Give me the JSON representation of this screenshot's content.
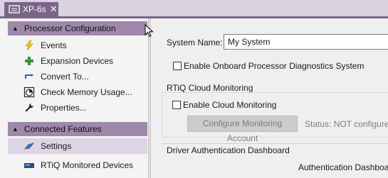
{
  "tab": {
    "title": "XP-6s",
    "close_glyph": "✕",
    "icon": "device-icon"
  },
  "sidebar": {
    "groups": [
      {
        "title": "Processor Configuration",
        "items": [
          {
            "label": "Events",
            "icon": "lightning-icon"
          },
          {
            "label": "Expansion Devices",
            "icon": "plus-icon"
          },
          {
            "label": "Convert To...",
            "icon": "convert-icon"
          },
          {
            "label": "Check Memory Usage...",
            "icon": "memory-icon"
          },
          {
            "label": "Properties...",
            "icon": "wrench-icon"
          }
        ]
      },
      {
        "title": "Connected Features",
        "items": [
          {
            "label": "Settings",
            "icon": "settings-icon",
            "selected": true
          },
          {
            "label": "RTiQ Monitored Devices",
            "icon": "device-icon"
          }
        ]
      }
    ]
  },
  "main": {
    "system_name_label": "System Name:",
    "system_name_value": "My System",
    "enable_onboard_label": "Enable Onboard Processor Diagnostics System",
    "cloud_section_title": "RTiQ Cloud Monitoring",
    "enable_cloud_label": "Enable Cloud Monitoring",
    "configure_button": "Configure Monitoring Account",
    "status_text": "Status: NOT configured",
    "driver_section_title": "Driver Authentication Dashboard",
    "driver_subtitle": "Authentication Dashboard"
  },
  "colors": {
    "accent": "#7a6588",
    "group_header": "#9e88ab",
    "selected": "#ddd5e4"
  }
}
